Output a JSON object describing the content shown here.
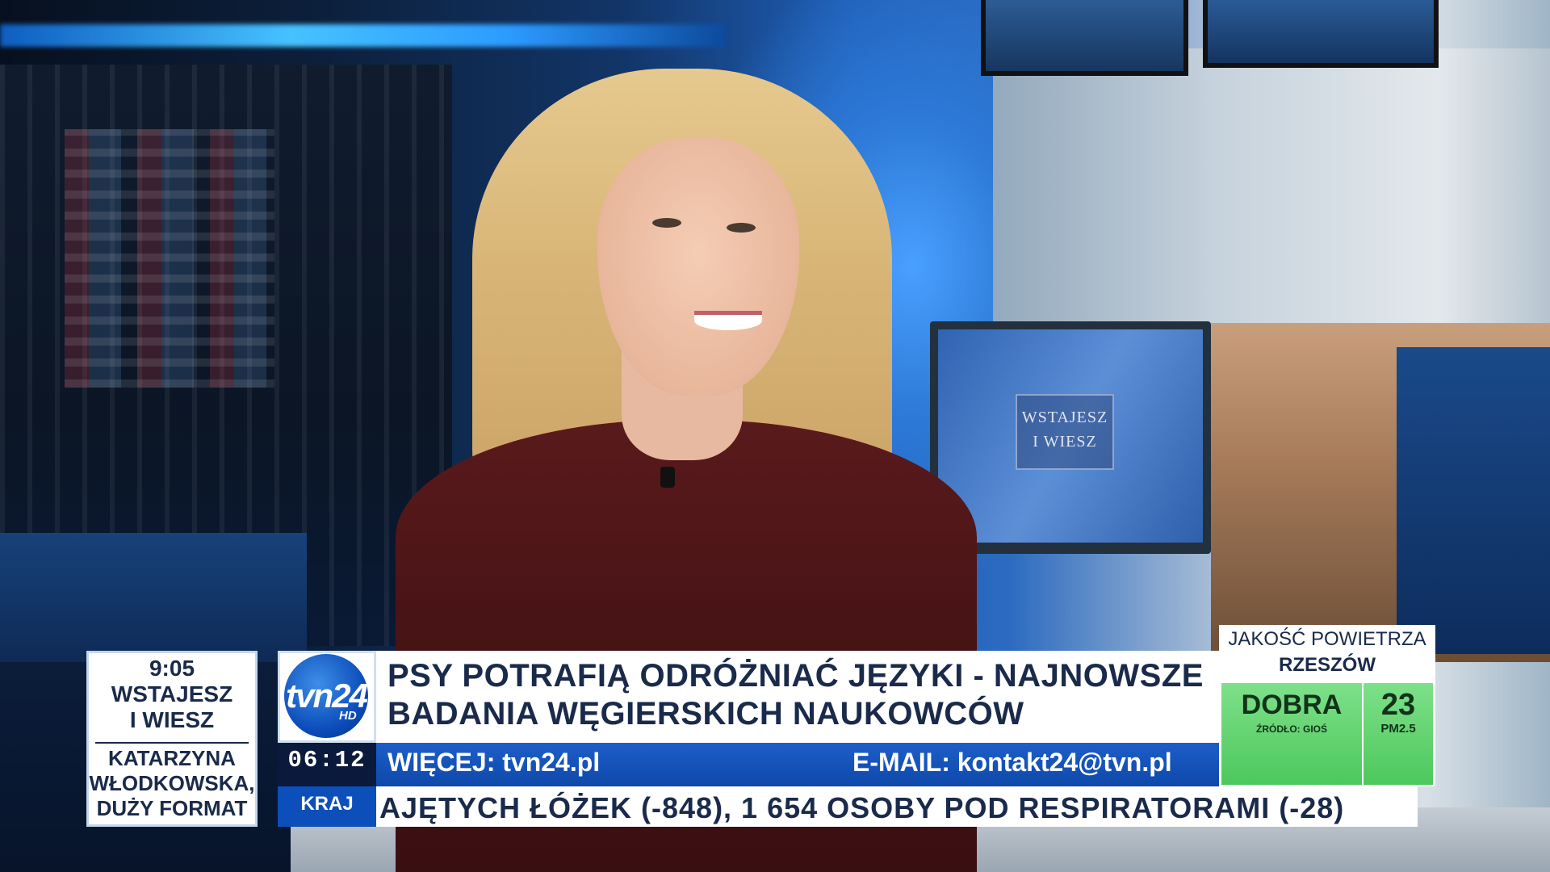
{
  "program": {
    "time": "9:05",
    "name_line1": "WSTAJESZ",
    "name_line2": "I WIESZ",
    "guest_line1": "KATARZYNA",
    "guest_line2": "WŁODKOWSKA,",
    "guest_line3": "DUŻY FORMAT"
  },
  "logo": {
    "text": "tvn24",
    "suffix": "HD"
  },
  "studio_monitor": {
    "line1": "WSTAJESZ",
    "line2": "I WIESZ"
  },
  "headline": {
    "line1": "PSY POTRAFIĄ ODRÓŻNIAĆ JĘZYKI - NAJNOWSZE",
    "line2": "BADANIA WĘGIERSKICH NAUKOWCÓW"
  },
  "info_bar": {
    "clock": "06:12",
    "more": "WIĘCEJ: tvn24.pl",
    "email": "E-MAIL: kontakt24@tvn.pl"
  },
  "ticker": {
    "section": "KRAJ",
    "text": "AJĘTYCH ŁÓŻEK (-848), 1 654 OSOBY POD RESPIRATORAMI (-28)"
  },
  "air_quality": {
    "title": "JAKOŚĆ POWIETRZA",
    "city": "RZESZÓW",
    "rating": "DOBRA",
    "source": "ŹRÓDŁO: GIOŚ",
    "value": "23",
    "unit": "PM2.5",
    "color": "#5fd46d"
  },
  "colors": {
    "brand_blue": "#0f48aa",
    "navy": "#0a1a3c",
    "text_dark": "#1a2a4a"
  }
}
